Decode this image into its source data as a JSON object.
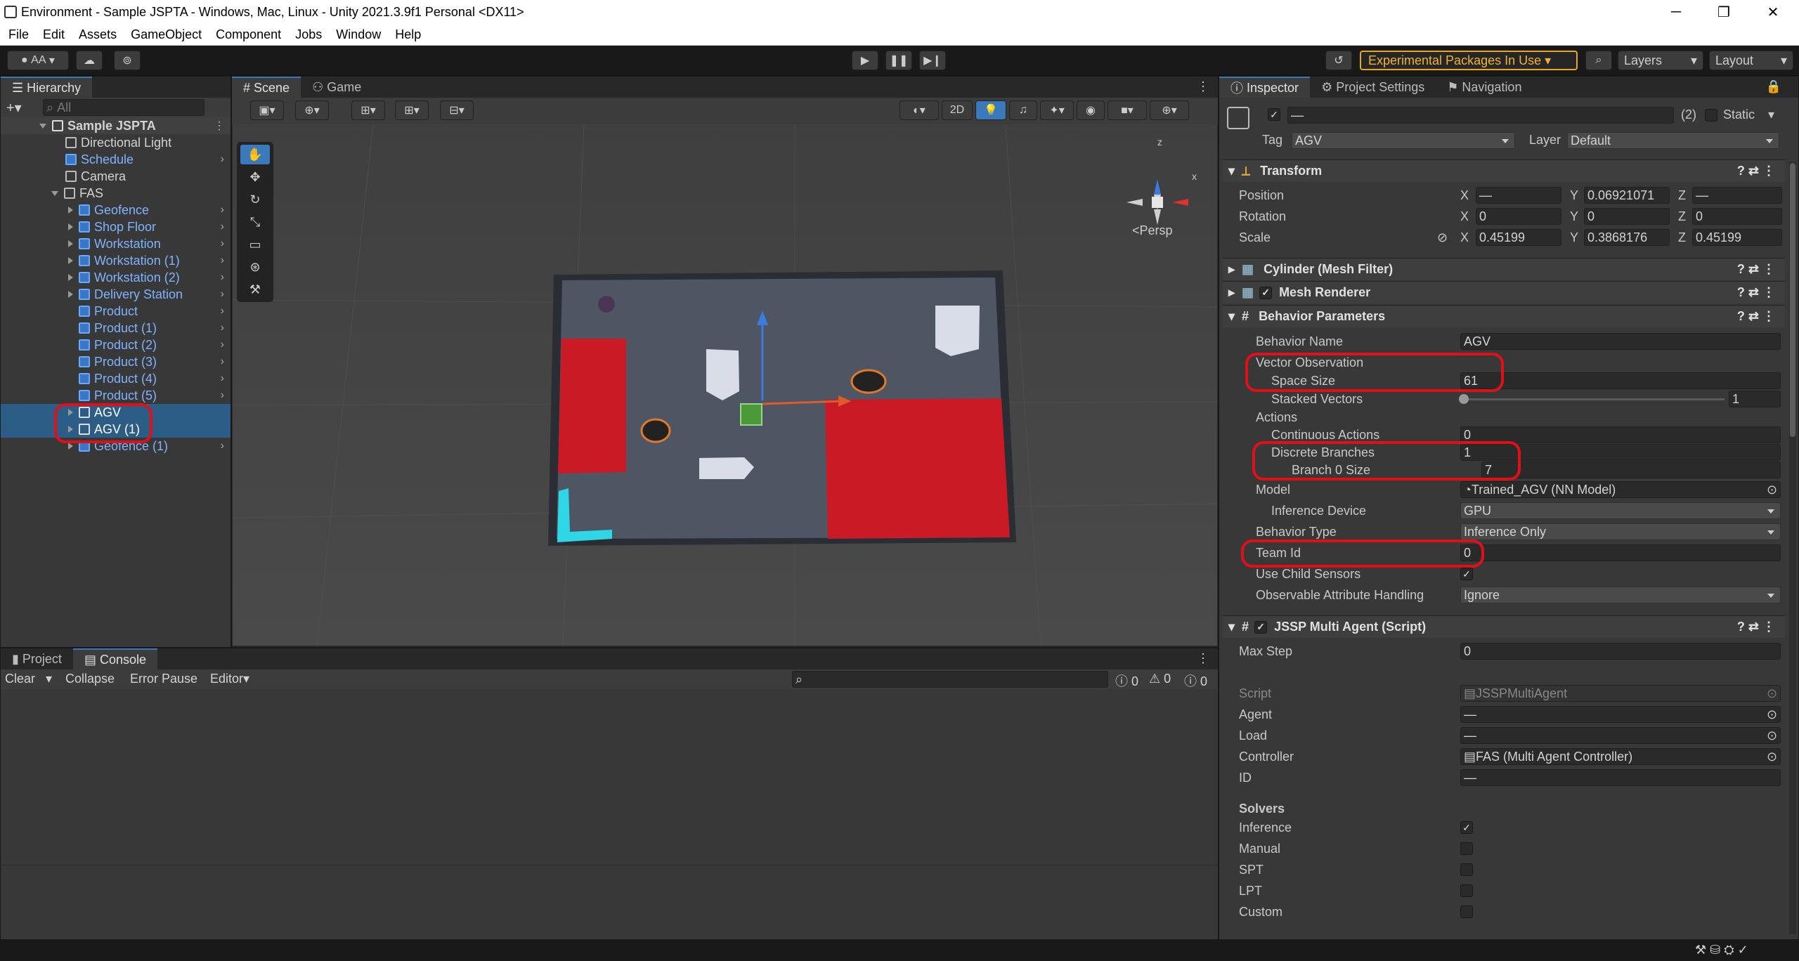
{
  "window": {
    "title": "Environment - Sample JSPTA - Windows, Mac, Linux - Unity 2021.3.9f1 Personal <DX11>",
    "minimize": "─",
    "maximize": "❐",
    "close": "✕"
  },
  "menu": [
    "File",
    "Edit",
    "Assets",
    "GameObject",
    "Component",
    "Jobs",
    "Window",
    "Help"
  ],
  "toolbar": {
    "account": "AA",
    "experimental": "Experimental Packages In Use",
    "layers": "Layers",
    "layout": "Layout"
  },
  "hierarchy": {
    "tab": "Hierarchy",
    "search_placeholder": "All",
    "scene": "Sample JSPTA",
    "items": [
      {
        "label": "Directional Light"
      },
      {
        "label": "Schedule"
      },
      {
        "label": "Camera"
      },
      {
        "label": "FAS"
      },
      {
        "label": "Geofence"
      },
      {
        "label": "Shop Floor"
      },
      {
        "label": "Workstation"
      },
      {
        "label": "Workstation (1)"
      },
      {
        "label": "Workstation (2)"
      },
      {
        "label": "Delivery Station"
      },
      {
        "label": "Product"
      },
      {
        "label": "Product (1)"
      },
      {
        "label": "Product (2)"
      },
      {
        "label": "Product (3)"
      },
      {
        "label": "Product (4)"
      },
      {
        "label": "Product (5)"
      },
      {
        "label": "AGV"
      },
      {
        "label": "AGV (1)"
      },
      {
        "label": "Geofence (1)"
      }
    ]
  },
  "scene": {
    "tab_scene": "Scene",
    "tab_game": "Game",
    "mode_2d": "2D",
    "persp": "Persp",
    "axis_x": "x",
    "axis_z": "z"
  },
  "console": {
    "tab_project": "Project",
    "tab_console": "Console",
    "clear": "Clear",
    "collapse": "Collapse",
    "error_pause": "Error Pause",
    "editor": "Editor",
    "count_log": "0",
    "count_warn": "0",
    "count_err": "0"
  },
  "inspector": {
    "tab_inspector": "Inspector",
    "tab_project_settings": "Project Settings",
    "tab_navigation": "Navigation",
    "object_name": "—",
    "object_count": "(2)",
    "static_label": "Static",
    "tag_label": "Tag",
    "tag_value": "AGV",
    "layer_label": "Layer",
    "layer_value": "Default",
    "transform": {
      "title": "Transform",
      "position_label": "Position",
      "rotation_label": "Rotation",
      "scale_label": "Scale",
      "pos_x": "—",
      "pos_y": "0.06921071",
      "pos_z": "—",
      "rot_x": "0",
      "rot_y": "0",
      "rot_z": "0",
      "scale_x": "0.45199",
      "scale_y": "0.3868176",
      "scale_z": "0.45199",
      "x": "X",
      "y": "Y",
      "z": "Z"
    },
    "mesh_filter": "Cylinder (Mesh Filter)",
    "mesh_renderer": "Mesh Renderer",
    "behavior": {
      "title": "Behavior Parameters",
      "behavior_name_label": "Behavior Name",
      "behavior_name": "AGV",
      "vector_obs": "Vector Observation",
      "space_size_label": "Space Size",
      "space_size": "61",
      "stacked_vectors_label": "Stacked Vectors",
      "stacked_vectors": "1",
      "stacked_fraction": 0.0,
      "actions": "Actions",
      "continuous_label": "Continuous Actions",
      "continuous": "0",
      "discrete_label": "Discrete Branches",
      "discrete": "1",
      "branch0_label": "Branch 0 Size",
      "branch0": "7",
      "model_label": "Model",
      "model": "Trained_AGV (NN Model)",
      "inference_device_label": "Inference Device",
      "inference_device": "GPU",
      "behavior_type_label": "Behavior Type",
      "behavior_type": "Inference Only",
      "team_id_label": "Team Id",
      "team_id": "0",
      "use_child_label": "Use Child Sensors",
      "observable_label": "Observable Attribute Handling",
      "observable": "Ignore"
    },
    "jssp": {
      "title": "JSSP Multi Agent (Script)",
      "max_step_label": "Max Step",
      "max_step": "0",
      "script_label": "Script",
      "script": "JSSPMultiAgent",
      "agent_label": "Agent",
      "agent": "—",
      "load_label": "Load",
      "load": "—",
      "controller_label": "Controller",
      "controller": "FAS (Multi Agent Controller)",
      "id_label": "ID",
      "id": "—",
      "solvers": "Solvers",
      "inference": "Inference",
      "manual": "Manual",
      "spt": "SPT",
      "lpt": "LPT",
      "custom": "Custom"
    }
  }
}
